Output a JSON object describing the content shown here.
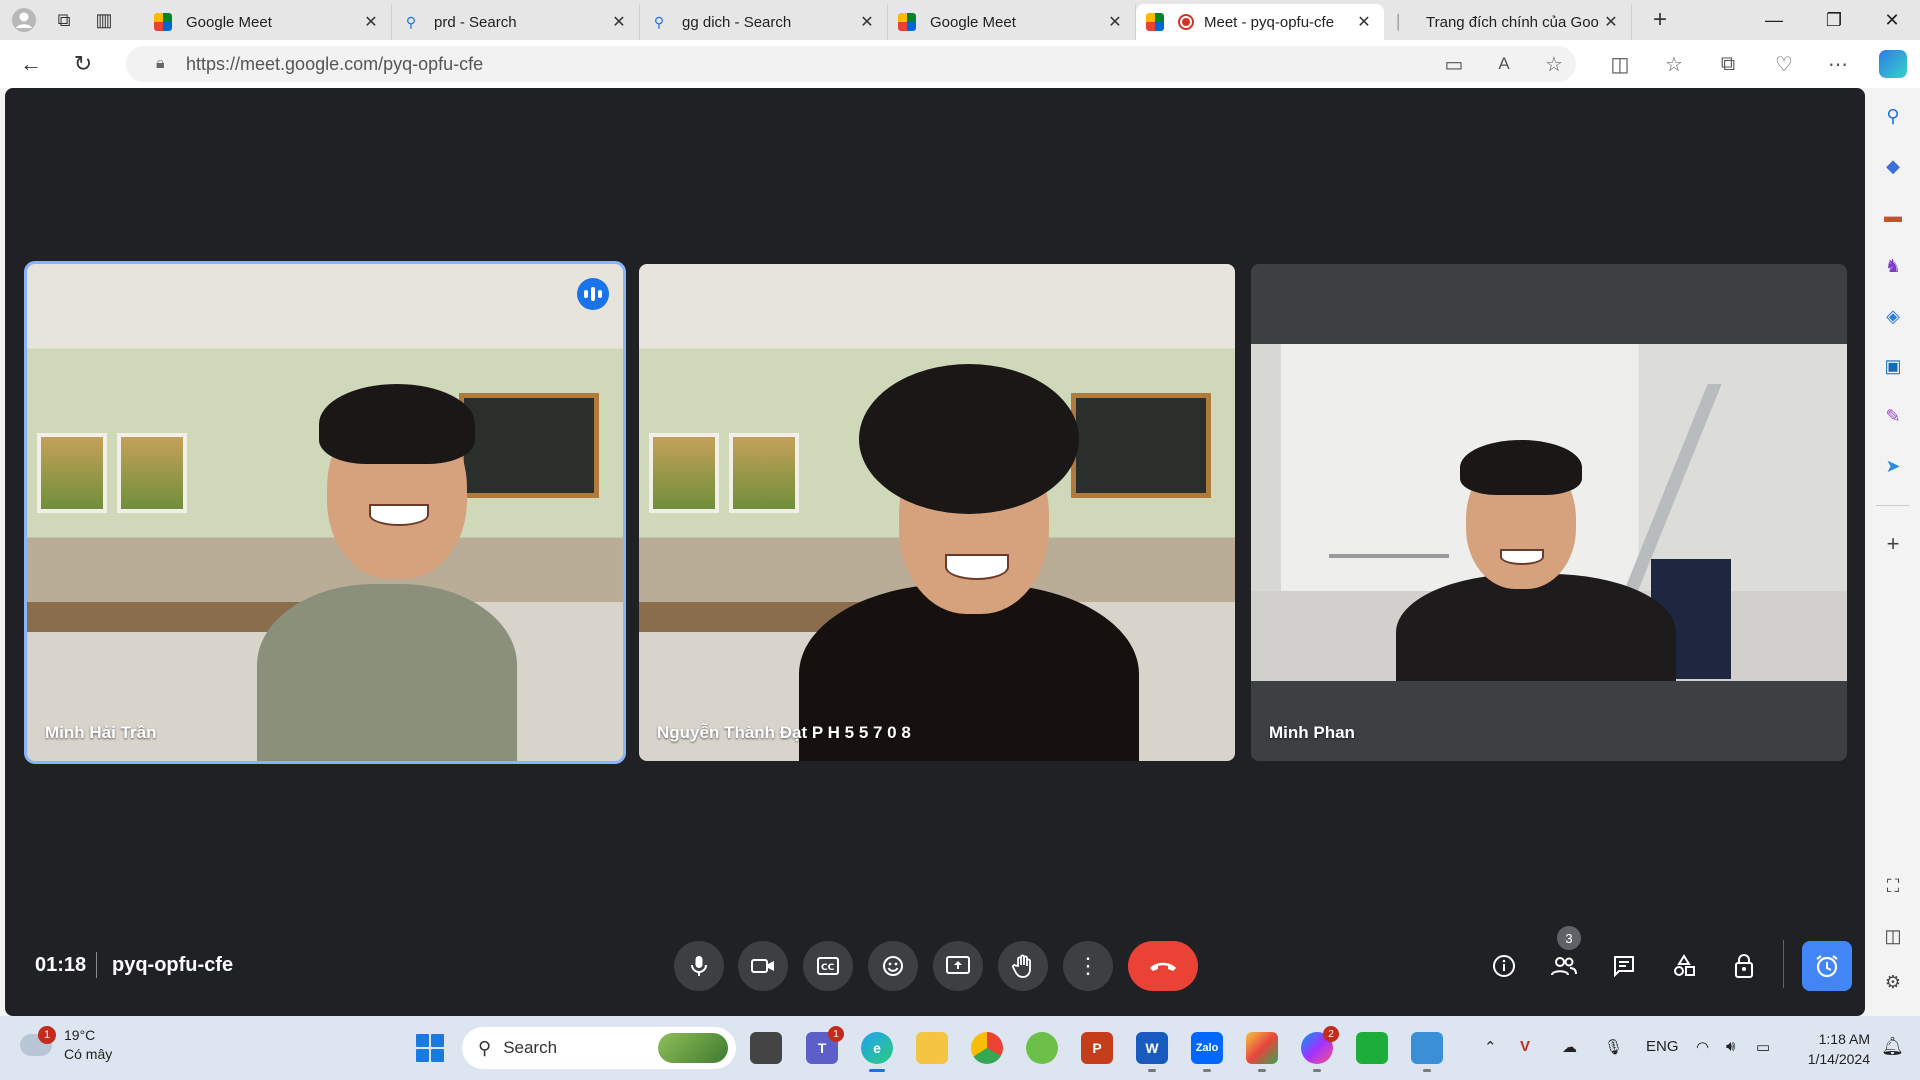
{
  "browser": {
    "tabs": [
      {
        "title": "Google Meet",
        "icon": "google-meet-icon"
      },
      {
        "title": "prd - Search",
        "icon": "search-icon"
      },
      {
        "title": "gg dich - Search",
        "icon": "search-icon"
      },
      {
        "title": "Google Meet",
        "icon": "google-meet-icon"
      },
      {
        "title": "Meet - pyq-opfu-cfe",
        "icon": "google-meet-icon",
        "active": true,
        "recording": true
      },
      {
        "title": "Trang đích chính của Goo",
        "icon": "page-icon"
      }
    ],
    "url": "https://meet.google.com/pyq-opfu-cfe"
  },
  "meet": {
    "participants": [
      {
        "name": "Minh Hải Trần",
        "speaking": true,
        "background": "classroom"
      },
      {
        "name": "Nguyễn Thành Đạt P H 5 5 7 0 8",
        "speaking": false,
        "background": "classroom"
      },
      {
        "name": "Minh Phan",
        "speaking": false,
        "background": "room"
      }
    ],
    "time": "01:18",
    "code": "pyq-opfu-cfe",
    "people_count": "3",
    "colors": {
      "bg": "#202124",
      "tile": "#3c4043",
      "speaking_outline": "#8ab4f8",
      "end_call": "#ea4335",
      "host": "#4285f4"
    }
  },
  "taskbar": {
    "weather_temp": "19°C",
    "weather_desc": "Có mây",
    "weather_badge": "1",
    "search_placeholder": "Search",
    "teams_badge": "1",
    "messenger_badge": "2",
    "language": "ENG",
    "time": "1:18 AM",
    "date": "1/14/2024"
  }
}
